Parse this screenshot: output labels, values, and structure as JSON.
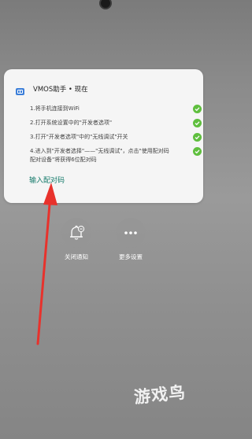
{
  "notification": {
    "app_name": "VMOS助手 • 现在",
    "steps": [
      "1.将手机连接到WiFi",
      "2.打开系统设置中的\"开发者选项\"",
      "3.打开\"开发者选项\"中的\"无线调试\"开关",
      "4.进入到\"开发者选择\"——\"无线调试\"，点击\"使用配对码",
      "配对设备\"将获得6位配对码"
    ],
    "action_label": "输入配对码"
  },
  "quick_actions": {
    "close_notifications": "关闭通知",
    "more_settings": "更多设置"
  },
  "watermark": "游戏鸟",
  "colors": {
    "check": "#5fbf3e",
    "action": "#147a6a",
    "arrow": "#e8322c"
  }
}
